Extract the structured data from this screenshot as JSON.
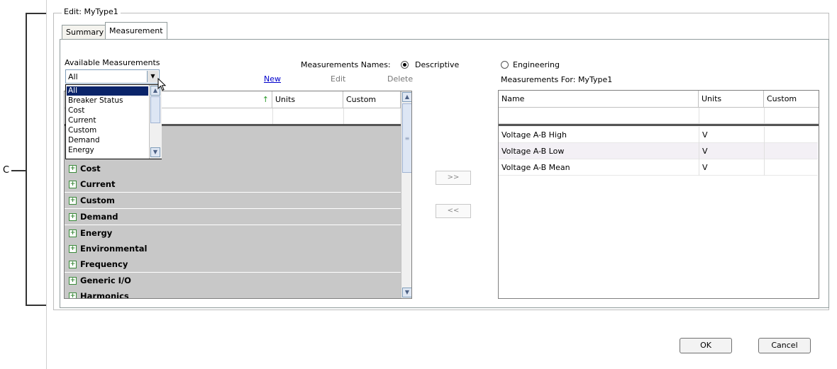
{
  "annotation": {
    "label": "C"
  },
  "groupbox": {
    "title": "Edit: MyType1"
  },
  "tabs": [
    {
      "label": "Summary",
      "active": false
    },
    {
      "label": "Measurement",
      "active": true
    }
  ],
  "available": {
    "label": "Available Measurements",
    "selected": "All",
    "options": [
      "All",
      "Breaker Status",
      "Cost",
      "Current",
      "Custom",
      "Demand",
      "Energy"
    ],
    "new": "New",
    "edit": "Edit",
    "delete": "Delete",
    "columns": {
      "name": "",
      "units": "Units",
      "custom": "Custom"
    },
    "categories": [
      "Cost",
      "Current",
      "Custom",
      "Demand",
      "Energy",
      "Environmental",
      "Frequency",
      "Generic I/O",
      "Harmonics"
    ]
  },
  "names_mode": {
    "label": "Measurements Names:",
    "descriptive": "Descriptive",
    "engineering": "Engineering",
    "selected": "descriptive"
  },
  "transfer": {
    "add": ">>",
    "remove": "<<"
  },
  "assigned": {
    "label": "Measurements For: MyType1",
    "columns": {
      "name": "Name",
      "units": "Units",
      "custom": "Custom"
    },
    "rows": [
      {
        "name": "Voltage A-B High",
        "units": "V",
        "custom": ""
      },
      {
        "name": "Voltage A-B Low",
        "units": "V",
        "custom": ""
      },
      {
        "name": "Voltage A-B Mean",
        "units": "V",
        "custom": ""
      }
    ]
  },
  "footer": {
    "ok": "OK",
    "cancel": "Cancel"
  }
}
